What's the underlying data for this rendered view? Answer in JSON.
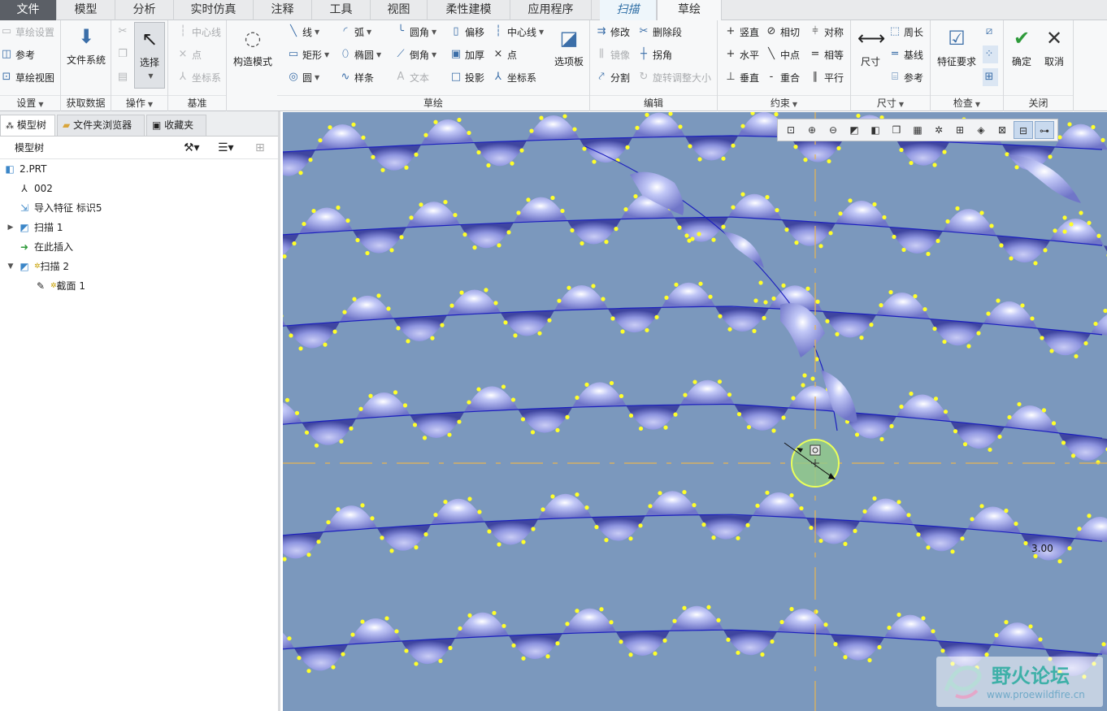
{
  "tabs": [
    {
      "label": "文件"
    },
    {
      "label": "模型"
    },
    {
      "label": "分析"
    },
    {
      "label": "实时仿真"
    },
    {
      "label": "注释"
    },
    {
      "label": "工具"
    },
    {
      "label": "视图"
    },
    {
      "label": "柔性建模"
    },
    {
      "label": "应用程序"
    },
    {
      "label": "扫描"
    },
    {
      "label": "草绘"
    }
  ],
  "ribbon": {
    "settings": {
      "sketch_setup": "草绘设置",
      "references": "参考",
      "sketch_view": "草绘视图",
      "title": "设置"
    },
    "get_data": {
      "file_system": "文件系统",
      "title": "获取数据"
    },
    "operations": {
      "select": "选择",
      "title": "操作"
    },
    "datum": {
      "centerline": "中心线",
      "point": "点",
      "csys": "坐标系",
      "title": "基准"
    },
    "construction_mode": "构造模式",
    "sketch": {
      "line": "线",
      "arc": "弧",
      "fillet": "圆角",
      "offset": "偏移",
      "centerline": "中心线",
      "rectangle": "矩形",
      "ellipse": "椭圆",
      "chamfer": "倒角",
      "thicken": "加厚",
      "point": "点",
      "circle": "圆",
      "spline": "样条",
      "text": "文本",
      "project": "投影",
      "csys": "坐标系",
      "palette": "选项板",
      "title": "草绘"
    },
    "editing": {
      "modify": "修改",
      "delete_segment": "删除段",
      "mirror": "镜像",
      "corner": "拐角",
      "divide": "分割",
      "rotate_resize": "旋转调整大小",
      "title": "编辑"
    },
    "constrain": {
      "vertical": "竖直",
      "tangent": "相切",
      "symmetric": "对称",
      "horizontal": "水平",
      "midpoint": "中点",
      "equal": "相等",
      "perpendicular": "垂直",
      "coincident": "重合",
      "parallel": "平行",
      "title": "约束"
    },
    "dimension": {
      "dimension": "尺寸",
      "perimeter": "周长",
      "baseline": "基线",
      "reference": "参考",
      "title": "尺寸"
    },
    "inspect": {
      "feature_requirements": "特征要求",
      "title": "检查"
    },
    "close": {
      "ok": "确定",
      "cancel": "取消",
      "title": "关闭"
    }
  },
  "panel": {
    "tabs": [
      "模型树",
      "文件夹浏览器",
      "收藏夹"
    ],
    "tree_header": "模型树",
    "tree": [
      {
        "label": "2.PRT"
      },
      {
        "label": "002"
      },
      {
        "label": "导入特征 标识5"
      },
      {
        "label": "扫描 1"
      },
      {
        "label": "在此插入"
      },
      {
        "label": "扫描 2"
      },
      {
        "label": "截面 1"
      }
    ]
  },
  "canvas": {
    "dimension_label": "3.00",
    "background_color": "#7b98bd",
    "surface_color": "#9fa6ee",
    "vertex_color": "#ffff2a",
    "curve_color": "#1c1fbe"
  },
  "watermark": {
    "title": "野火论坛",
    "url": "www.proewildfire.cn"
  }
}
